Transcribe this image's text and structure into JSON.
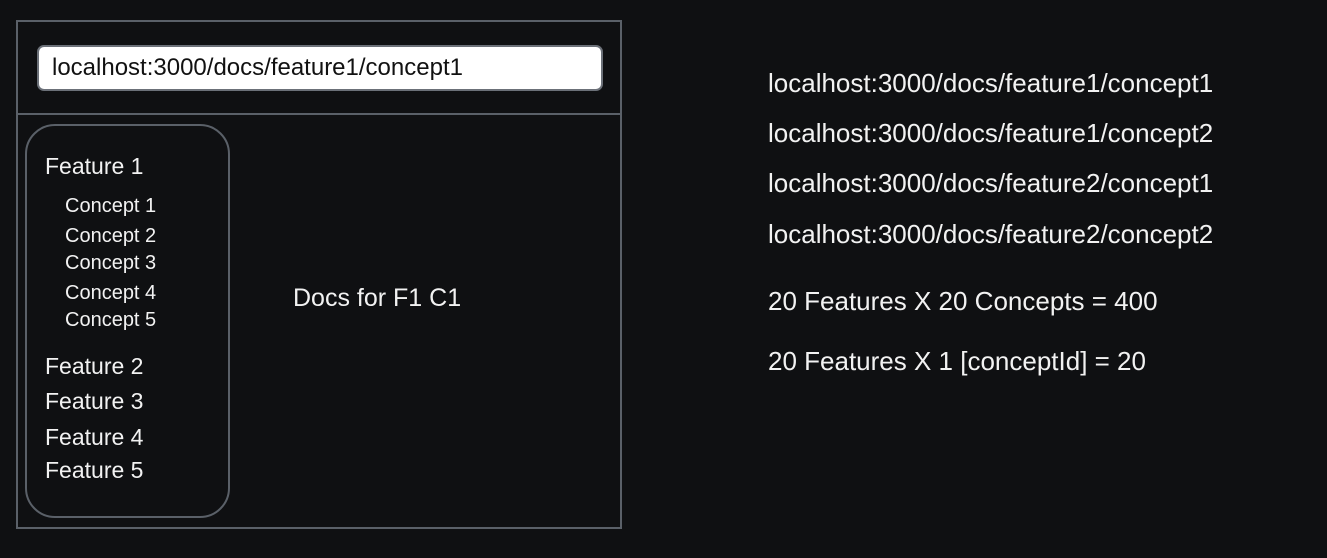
{
  "browser": {
    "address_url": "localhost:3000/docs/feature1/concept1"
  },
  "sidebar": {
    "features": [
      {
        "label": "Feature 1",
        "concepts": [
          "Concept 1",
          "Concept 2",
          "Concept 3",
          "Concept 4",
          "Concept 5"
        ]
      },
      {
        "label": "Feature 2"
      },
      {
        "label": "Feature 3"
      },
      {
        "label": "Feature 4"
      },
      {
        "label": "Feature 5"
      }
    ]
  },
  "content": {
    "text": "Docs for F1 C1"
  },
  "notes": {
    "urls": [
      "localhost:3000/docs/feature1/concept1",
      "localhost:3000/docs/feature1/concept2",
      "localhost:3000/docs/feature2/concept1",
      "localhost:3000/docs/feature2/concept2"
    ],
    "calc_static": "20 Features X 20 Concepts = 400",
    "calc_dynamic": "20 Features X 1 [conceptId] = 20"
  }
}
